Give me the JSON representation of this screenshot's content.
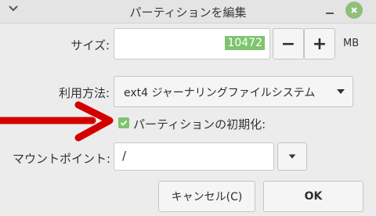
{
  "window": {
    "title": "パーティションを編集"
  },
  "size": {
    "label": "サイズ:",
    "value": "10472",
    "decrement": "−",
    "increment": "+",
    "unit": "MB"
  },
  "usage": {
    "label": "利用方法:",
    "selected": "ext4 ジャーナリングファイルシステム"
  },
  "format": {
    "label": "パーティションの初期化:",
    "checked": true
  },
  "mount": {
    "label": "マウントポイント:",
    "value": "/"
  },
  "buttons": {
    "cancel": "キャンセル(C)",
    "ok": "OK"
  },
  "colors": {
    "accent": "#7ec46e",
    "annotation_arrow": "#d40000"
  }
}
